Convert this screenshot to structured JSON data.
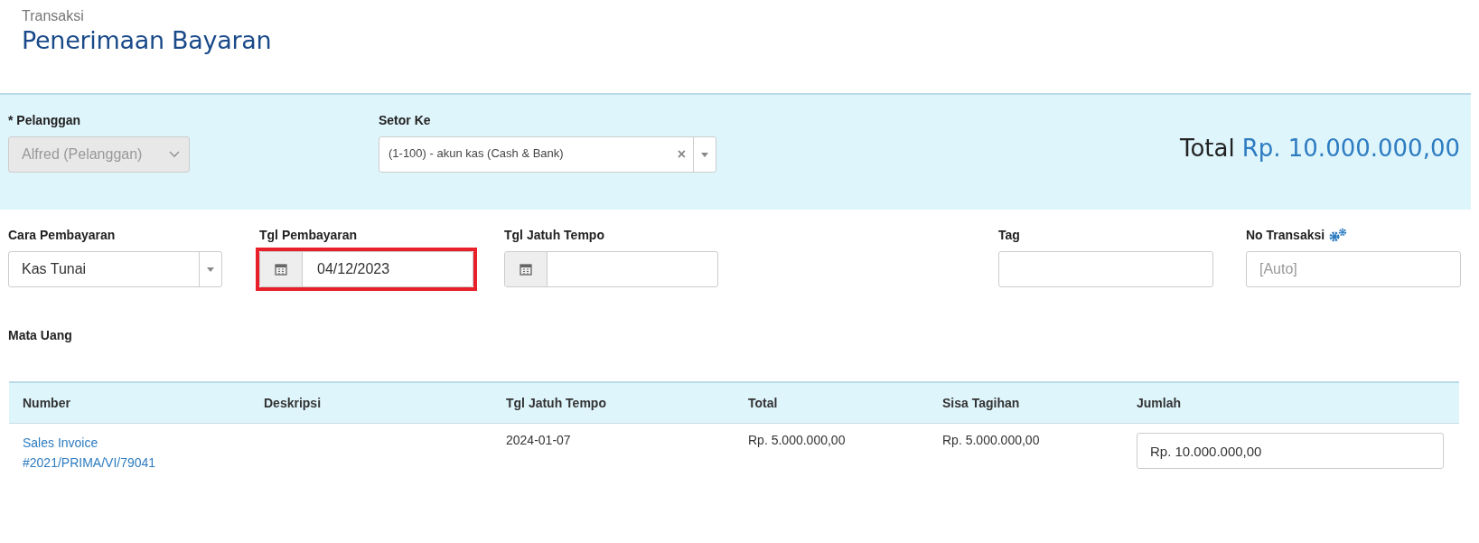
{
  "header": {
    "breadcrumb": "Transaksi",
    "title": "Penerimaan Bayaran"
  },
  "customer": {
    "label": "* Pelanggan",
    "value": "Alfred (Pelanggan)",
    "disabled": true
  },
  "deposit_to": {
    "label": "Setor Ke",
    "value": "(1-100) - akun kas (Cash & Bank)",
    "clear": "×"
  },
  "total": {
    "label": "Total",
    "amount": "Rp. 10.000.000,00"
  },
  "payment_method": {
    "label": "Cara Pembayaran",
    "value": "Kas Tunai"
  },
  "payment_date": {
    "label": "Tgl Pembayaran",
    "value": "04/12/2023",
    "highlighted": true
  },
  "due_date": {
    "label": "Tgl Jatuh Tempo"
  },
  "tag": {
    "label": "Tag"
  },
  "transaction_no": {
    "label": "No Transaksi",
    "placeholder": "[Auto]"
  },
  "currency": {
    "label": "Mata Uang"
  },
  "table": {
    "columns": [
      "Number",
      "Deskripsi",
      "Tgl Jatuh Tempo",
      "Total",
      "Sisa Tagihan",
      "Jumlah"
    ],
    "rows": [
      {
        "number": "Sales Invoice #2021/PRIMA/VI/79041",
        "due": "2024-01-07",
        "total": "Rp. 5.000.000,00",
        "remaining": "Rp. 5.000.000,00",
        "amount": "Rp. 10.000.000,00"
      }
    ]
  }
}
